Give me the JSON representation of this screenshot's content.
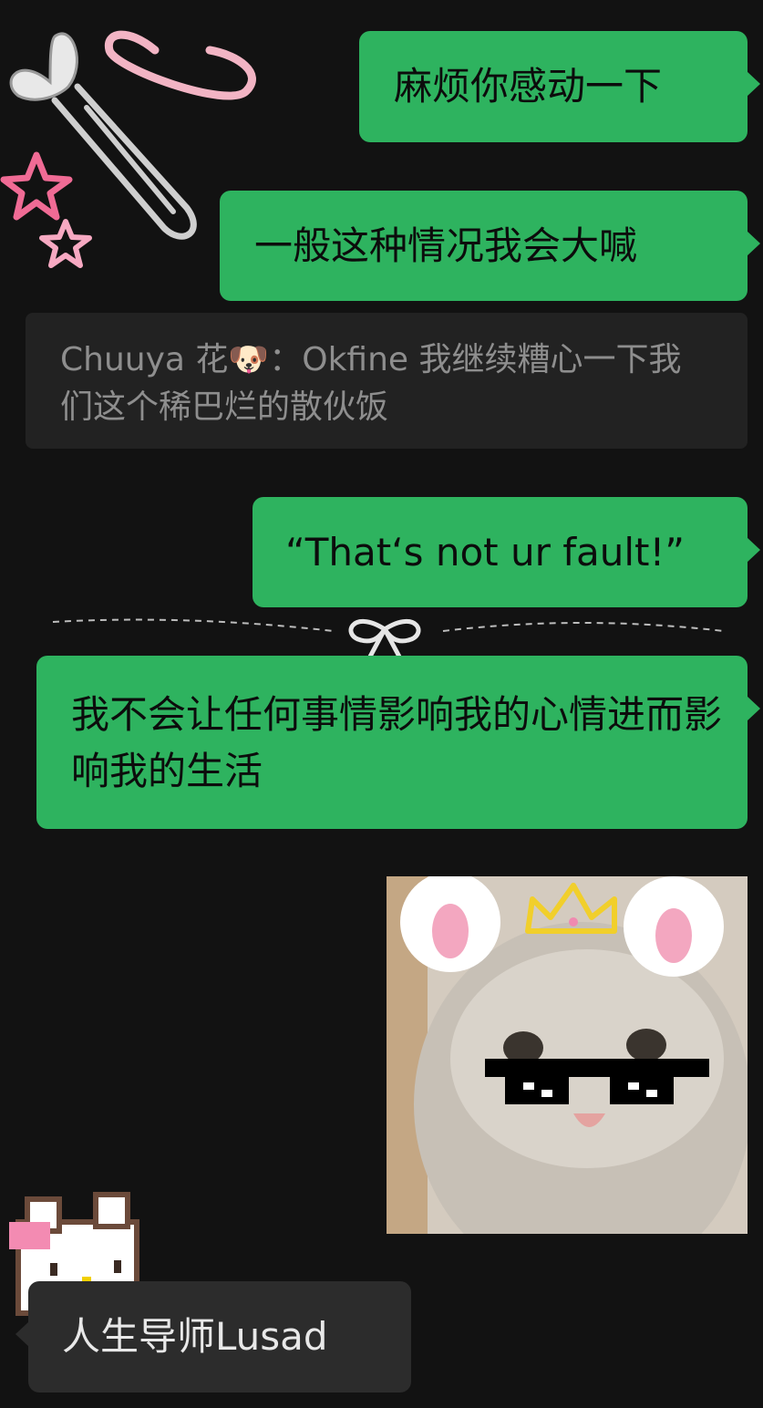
{
  "messages": [
    {
      "side": "out",
      "text": "麻烦你感动一下"
    },
    {
      "side": "out",
      "text": "一般这种情况我会大喊"
    },
    {
      "side": "out",
      "text": "“That‘s not ur fault!”"
    },
    {
      "side": "out",
      "text": "我不会让任何事情影响我的心情进而影响我的生活"
    },
    {
      "side": "in",
      "text": "人生导师Lusad"
    }
  ],
  "quote": {
    "sender": "Chuuya 花",
    "emoji": "🐶",
    "separator": "：",
    "text": "Okfine 我继续糟心一下我们这个稀巴烂的散伙饭"
  },
  "meme_sticker": {
    "description_icon": "cat-sticker-icon"
  },
  "decorations": {
    "clip": "paperclip-icon",
    "hearts": "heart-icon",
    "stars": "star-icon",
    "bow": "bow-icon",
    "pixel": "pixel-cat-icon"
  },
  "colors": {
    "bubble_out": "#2eb35f",
    "bubble_in": "#2c2c2c",
    "background": "#121212",
    "quote_bg": "#222222"
  }
}
